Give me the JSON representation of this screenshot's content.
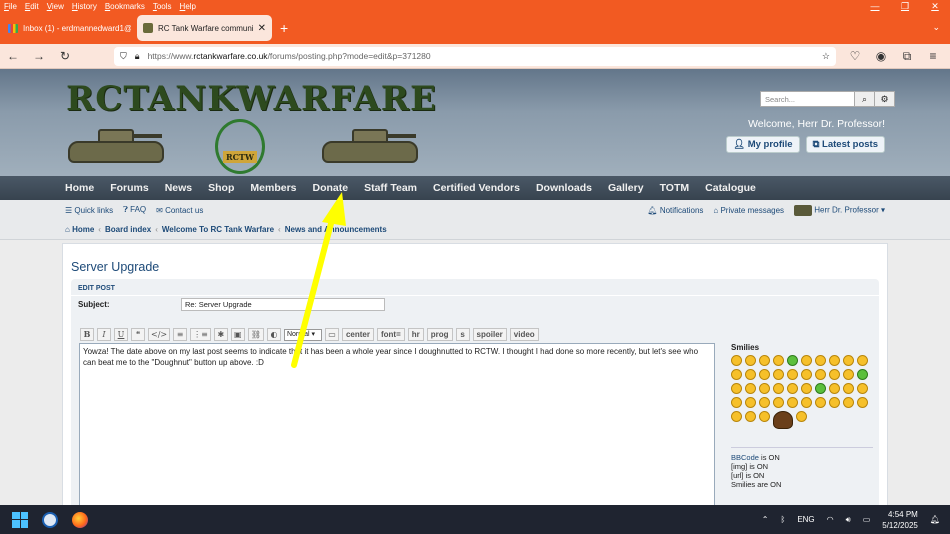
{
  "browser": {
    "menu": [
      "File",
      "Edit",
      "View",
      "History",
      "Bookmarks",
      "Tools",
      "Help"
    ],
    "window_controls": [
      "⌄",
      "—",
      "❐",
      "✕"
    ],
    "tabs": [
      {
        "label": "Inbox (1) - erdmannedward1@..."
      },
      {
        "label": "RC Tank Warfare community ho..."
      }
    ],
    "new_tab": "+",
    "url_prefix": "https://www.",
    "url_domain": "rctankwarfare.co.uk",
    "url_path": "/forums/posting.php?mode=edit&p=371280"
  },
  "header": {
    "logo": "RCTANKWARFARE",
    "emblem": "RCTW",
    "search_placeholder": "Search...",
    "welcome": "Welcome, Herr Dr. Professor!",
    "my_profile": "My profile",
    "latest_posts": "Latest posts"
  },
  "mainnav": [
    "Home",
    "Forums",
    "News",
    "Shop",
    "Members",
    "Donate",
    "Staff Team",
    "Certified Vendors",
    "Downloads",
    "Gallery",
    "TOTM",
    "Catalogue"
  ],
  "quickbar": {
    "quick_links": "Quick links",
    "faq": "FAQ",
    "contact": "Contact us",
    "notifications": "Notifications",
    "private_messages": "Private messages",
    "user": "Herr Dr. Professor"
  },
  "breadcrumbs": [
    "Home",
    "Board index",
    "Welcome To RC Tank Warfare",
    "News and Announcements"
  ],
  "post": {
    "title": "Server Upgrade",
    "panel_heading": "EDIT POST",
    "subject_label": "Subject:",
    "subject_value": "Re: Server Upgrade",
    "toolbar": [
      "B",
      "I",
      "U",
      "❝",
      "</>",
      "≡",
      "⋮≡",
      "✱",
      "▣",
      "⛓",
      "◐"
    ],
    "font_size": "Normal",
    "toolbar_text": [
      "center",
      "font=",
      "hr",
      "prog",
      "s",
      "spoiler",
      "video"
    ],
    "body": "Yowza! The date above on my last post seems to indicate that it has been a whole year since I doughnutted to RCTW. I thought I had done so more recently, but let's see who can beat me to the \"Doughnut\" button up above.  :D",
    "smilies_title": "Smilies",
    "bbcode_label": "BBCode",
    "bbcode_state": " is ON",
    "img": "[img] is ON",
    "url": "[url] is ON",
    "smilies_state": "Smilies are ON"
  },
  "taskbar": {
    "lang": "ENG",
    "time": "4:54 PM",
    "date": "5/12/2025"
  },
  "colors": {
    "browser_accent": "#f25a22",
    "link": "#1d4a78",
    "annotation_arrow": "#ffff00"
  }
}
